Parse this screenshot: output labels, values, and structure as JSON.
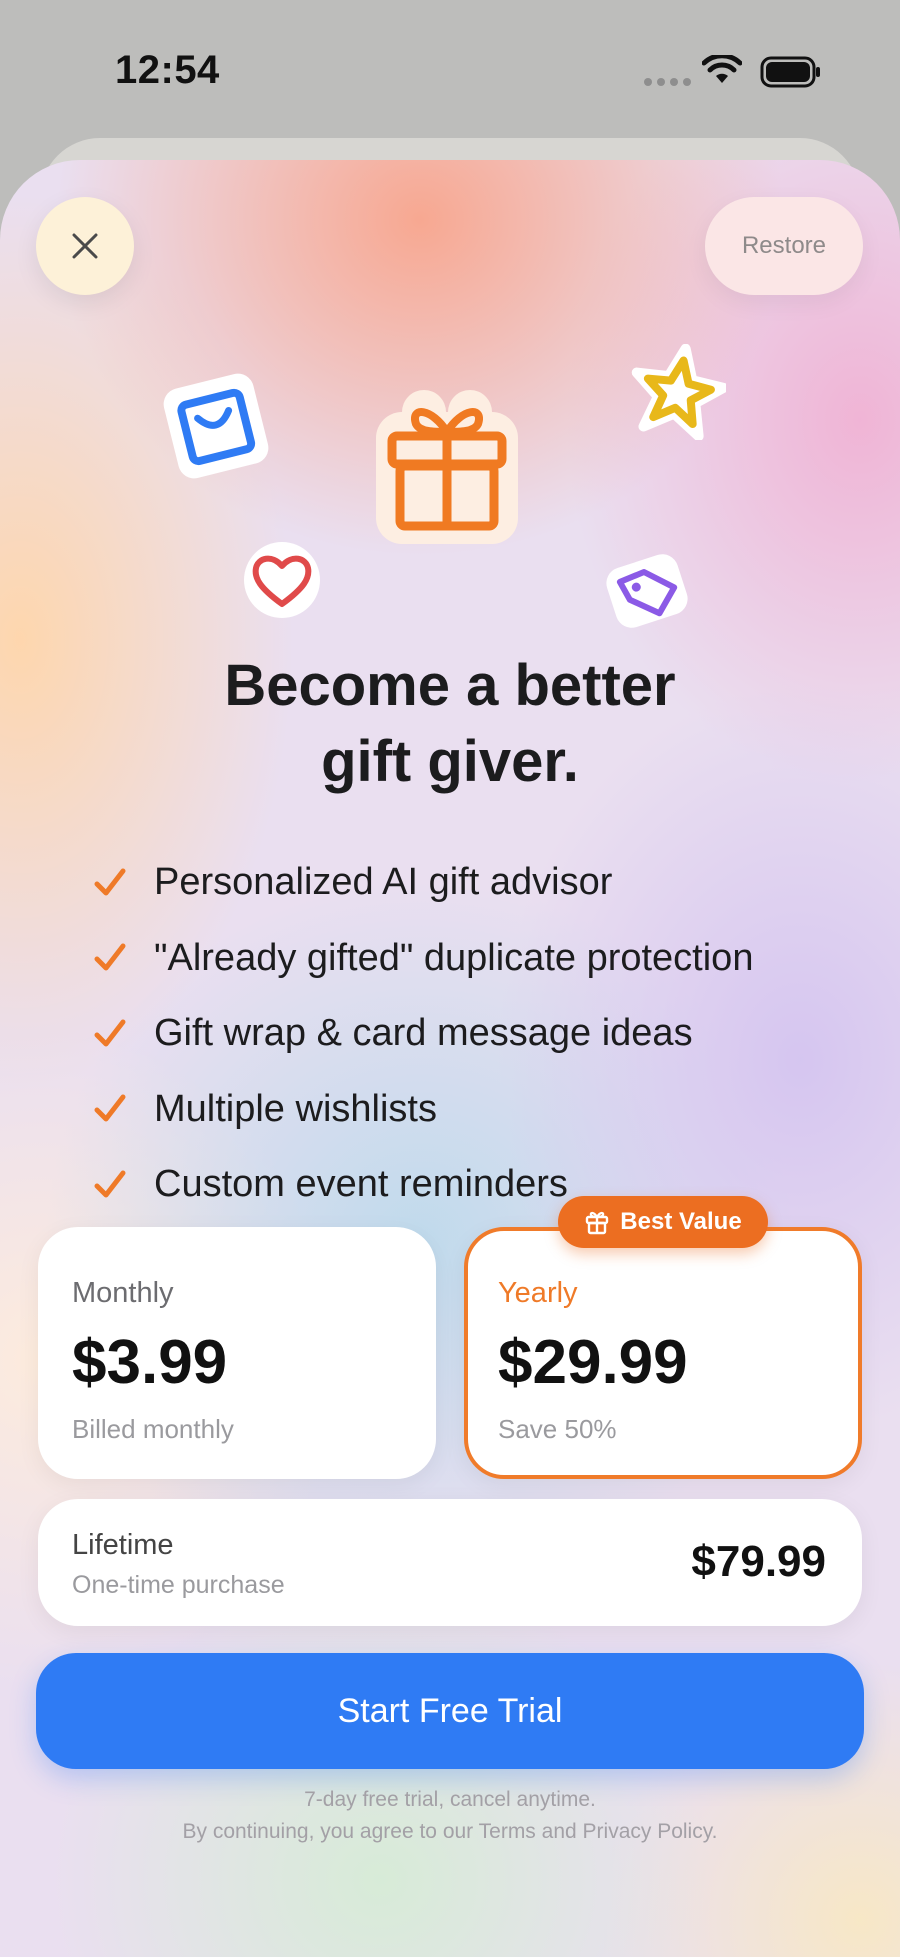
{
  "status_bar": {
    "time": "12:54"
  },
  "header": {
    "restore_label": "Restore"
  },
  "hero": {
    "title_line1": "Become a better",
    "title_line2": "gift giver.",
    "stickers": [
      "shopping-bag-icon",
      "gift-icon",
      "star-icon",
      "heart-icon",
      "tag-icon"
    ]
  },
  "features": [
    "Personalized AI gift advisor",
    "\"Already gifted\" duplicate protection",
    "Gift wrap & card message ideas",
    "Multiple wishlists",
    "Custom event reminders"
  ],
  "plans": {
    "monthly": {
      "name": "Monthly",
      "price": "$3.99",
      "note": "Billed monthly"
    },
    "yearly": {
      "name": "Yearly",
      "price": "$29.99",
      "note": "Save 50%",
      "badge": "Best Value",
      "selected": true
    },
    "lifetime": {
      "name": "Lifetime",
      "note": "One-time purchase",
      "price": "$79.99"
    }
  },
  "cta": {
    "label": "Start Free Trial"
  },
  "footer": {
    "trial_note": "7-day free trial, cancel anytime.",
    "legal_prefix": "By continuing, you agree to our ",
    "terms": "Terms",
    "and": " and ",
    "privacy": "Privacy Policy",
    "suffix": "."
  },
  "colors": {
    "accent_orange": "#ec6e21",
    "cta_blue": "#2f7bf4"
  }
}
